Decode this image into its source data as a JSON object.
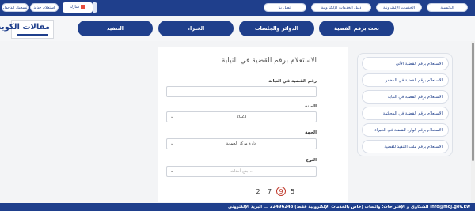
{
  "topbar": {
    "nav": [
      "الرئيسية",
      "الخدمات الإلكترونية",
      "دليل الخدمات الإلكترونية",
      "اتصل بنا"
    ],
    "share_label": "شارك",
    "new_service": "استعلام جديد",
    "login": "تسجيل الدخول"
  },
  "header": {
    "logo_text": "مقالات الكويت",
    "tabs": [
      "بحث برقم القضية",
      "الدوائر والجلسات",
      "الخبراء",
      "التنفيذ"
    ]
  },
  "sidebar": {
    "items": [
      "الاستعلام برقم القضية الآلي",
      "الاستعلام برقم القضية في المخفر",
      "الاستعلام برقم القضية في النيابة",
      "الاستعلام برقم القضية في المحكمة",
      "الاستعلام برقم الوارد للقضية في الخبراء",
      "الاستعلام برقم ملف التنفيذ للقضية"
    ]
  },
  "form": {
    "title": "الاستعلام برقم القضية في النيابة",
    "case_label": "رقم القضية في النيابة",
    "case_value": "",
    "year_label": "السنة",
    "year_value": "2023",
    "entity_label": "الجهة",
    "entity_value": "ادارة مركز الحماية",
    "type_label": "النوع",
    "type_placeholder": "جنح أحداث..."
  },
  "captcha": [
    "2",
    "7",
    "9",
    "5"
  ],
  "footer": {
    "text": "الشكاوى و الإقتراحات: واتساب (خاص بالخدمات الإلكترونية فقط) 22496248 ... البريد الإلكتروني info@moj.gov.kw"
  },
  "colors": {
    "primary": "#1f3f8c",
    "accent": "#c0392b"
  }
}
